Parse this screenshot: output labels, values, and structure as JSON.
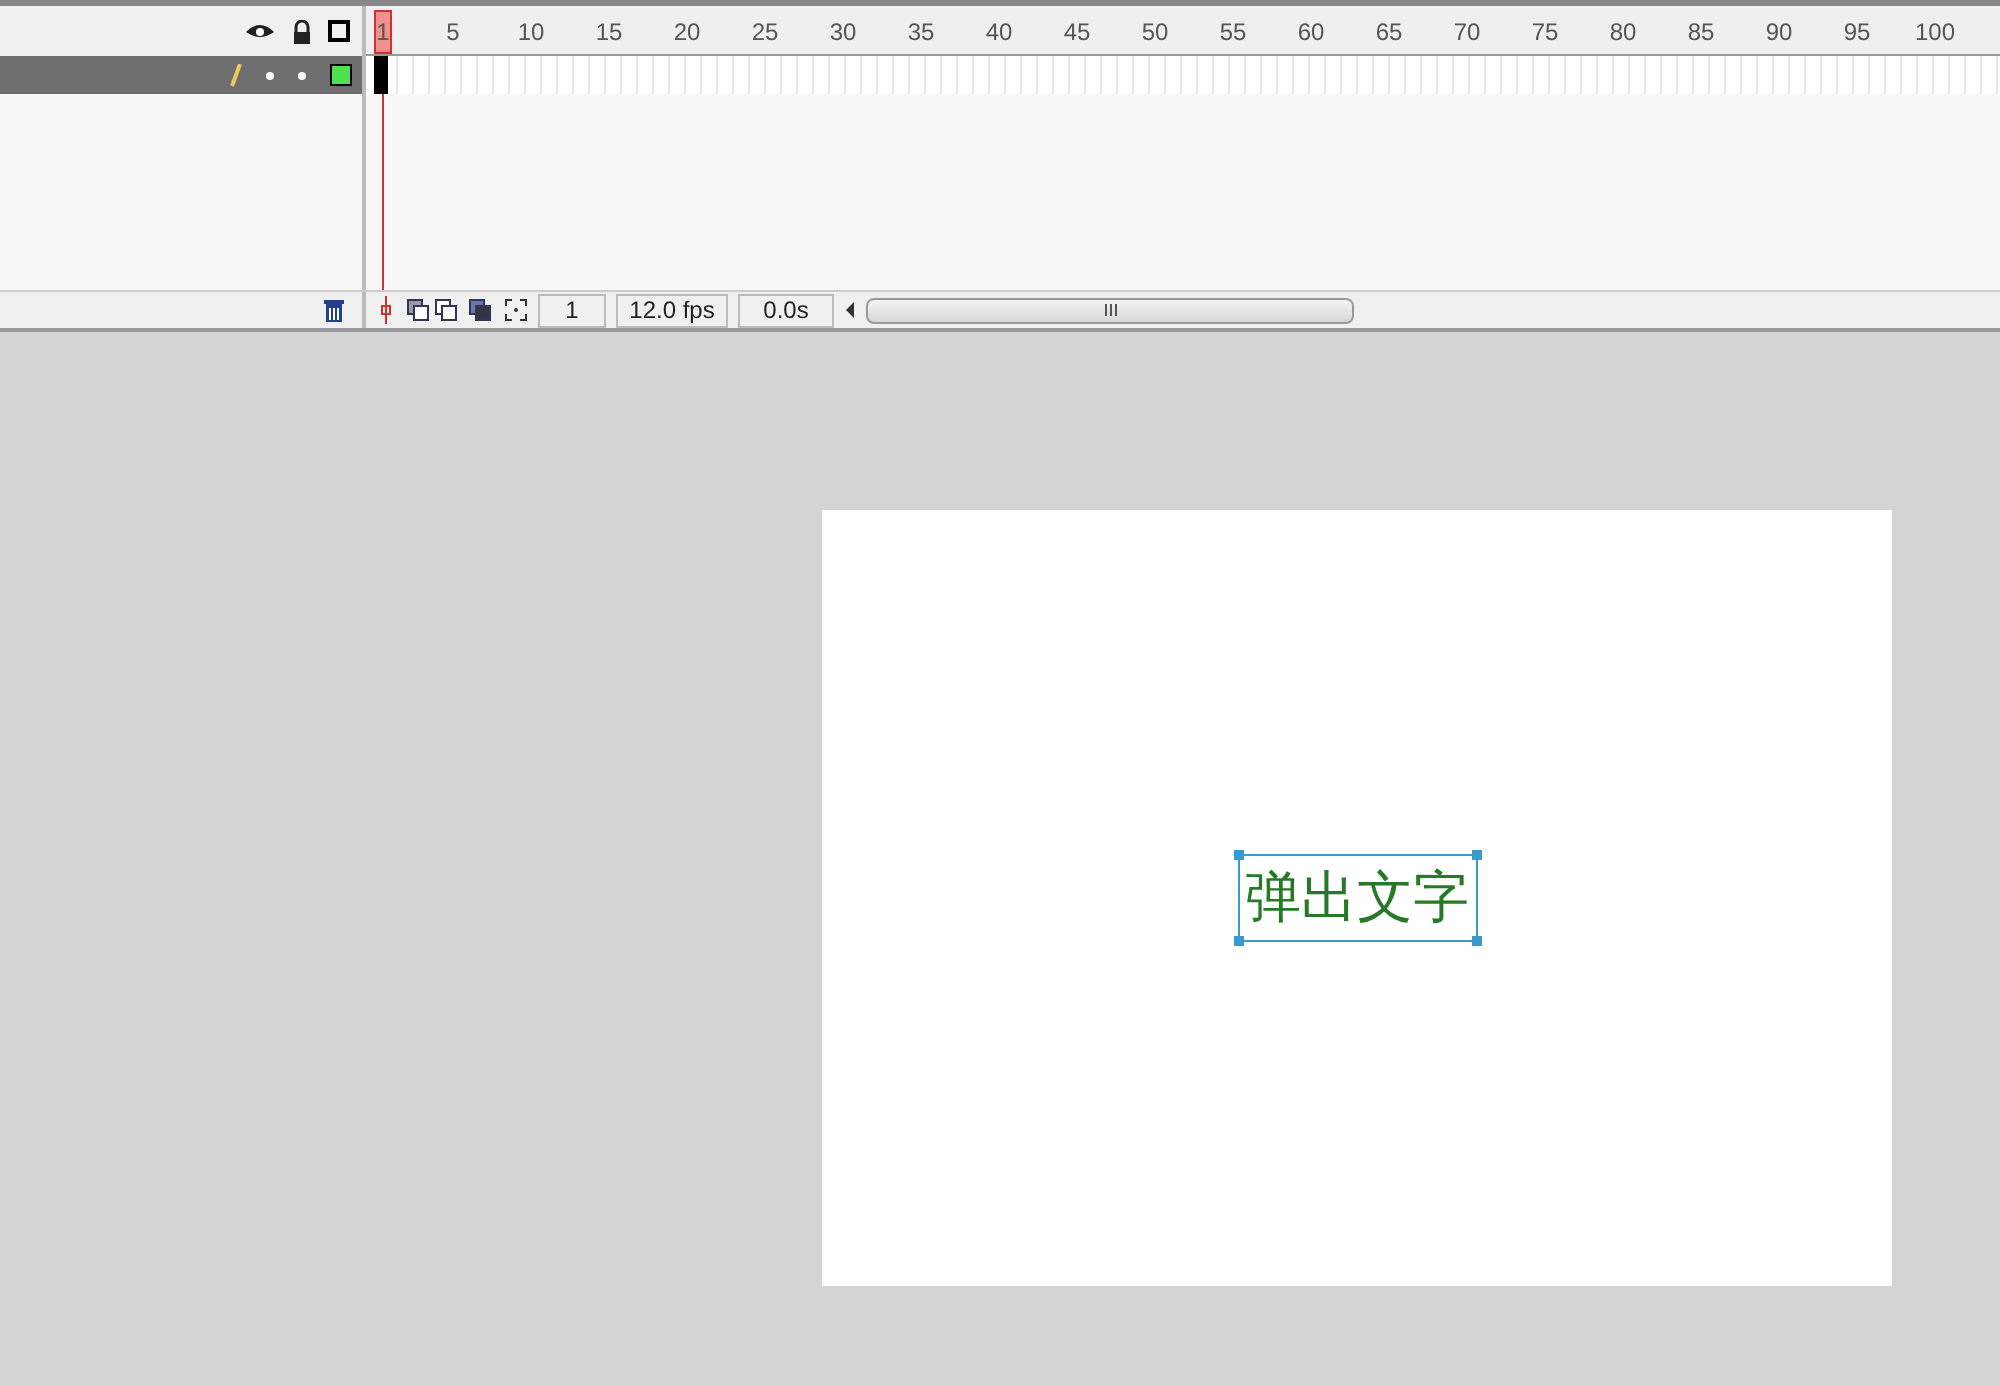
{
  "timeline": {
    "current_frame_label": "1",
    "frame_labels": [
      "5",
      "10",
      "15",
      "20",
      "25",
      "30",
      "35",
      "40",
      "45",
      "50",
      "55",
      "60",
      "65",
      "70",
      "75",
      "80",
      "85",
      "90",
      "95",
      "100"
    ],
    "layers": [
      {
        "selected": true,
        "color": "#4fe04f"
      }
    ],
    "status": {
      "frame": "1",
      "frame_rate": "12.0 fps",
      "elapsed": "0.0s"
    }
  },
  "stage": {
    "text": {
      "value": "弹出文字",
      "selected": true
    }
  }
}
